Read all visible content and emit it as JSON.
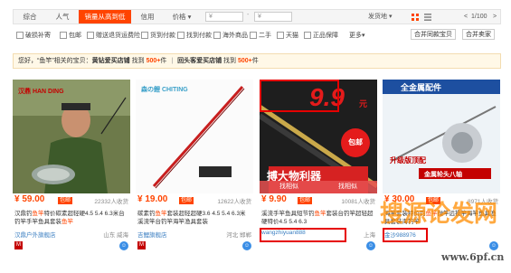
{
  "sortbar": {
    "tabs": [
      "综合",
      "人气",
      "销量从高到低",
      "信用",
      "价格"
    ],
    "price_from_placeholder": "¥",
    "price_dash": "-",
    "price_to_placeholder": "¥",
    "ship_from": "发货地",
    "page_indicator": "1/100",
    "prev": "<",
    "next": ">"
  },
  "filters": {
    "checkboxes": [
      "破损补寄",
      "包邮",
      "赠送退货运费险",
      "货到付款",
      "找到付款",
      "海外商品",
      "二手",
      "天猫",
      "正品保障"
    ],
    "more": "更多",
    "btn_merge_purchase": "合并同款宝贝",
    "btn_merge_seller": "合并卖家"
  },
  "notice": {
    "prefix": "您好，“鱼竿”相关的宝贝：",
    "gold": "黄钻爱买店铺",
    "found1": "找到",
    "count1": "500+",
    "unit1": "件",
    "sep": "|",
    "return": "回头客爱买店铺",
    "found2": "找到",
    "count2": "500+",
    "unit2": "件"
  },
  "products": [
    {
      "price": "¥ 59.00",
      "badge": "包邮",
      "sales": "22332人收货",
      "title_pre": "汉鼎钓",
      "title_kw": "鱼竿",
      "title_post": "特价碳素超轻硬4.5 5.4 6.3米台钓竿手竿鱼具套装",
      "title_kw2": "鱼竿",
      "shop": "汉鼎户外旗舰店",
      "location": "山东 威海",
      "img_brand": "汉鼎 HAN DING"
    },
    {
      "price": "¥ 19.00",
      "badge": "包邮",
      "sales": "12622人收货",
      "title_pre": "碳素钓",
      "title_kw": "鱼竿",
      "title_post": "套装超轻超硬3.6 4.5 5.4 6.3米溪流竿台钓竿海竿渔具套装",
      "title_kw2": "",
      "shop": "吉鲤旗舰店",
      "location": "河北 邯郸",
      "img_brand": "森の鲤 CHITING"
    },
    {
      "price": "¥ 9.90",
      "badge": "包邮",
      "sales": "10081人收货",
      "title_pre": "溪流手竿鱼具短节钓",
      "title_kw": "鱼竿",
      "title_post": "套装台钓竿超轻超硬特价4.5 5.4 6.3",
      "title_kw2": "",
      "shop": "wangzhiyuan888",
      "location": "上海",
      "img_price": "9.9",
      "img_yuan": "元",
      "img_mail": "包邮",
      "img_slogan": "搏大物利器",
      "tab_left": "找相似",
      "tab_right": "找相似"
    },
    {
      "price": "¥ 30.00",
      "badge": "包邮",
      "sales": "8971人收货",
      "title_pre": "海竿套装特价钓",
      "title_kw": "鱼竿",
      "title_post": "抛竿远投竿海竿鱼具渔具套装海钓竿",
      "title_kw2": "",
      "shop": "金沙988976",
      "location": "",
      "img_banner": "全金属配件",
      "img_tag1": "升级版顶配",
      "img_tag2": "金属轮头八轴"
    }
  ],
  "watermark": {
    "cn": "搜源论发网",
    "url": "www.6pf.cn"
  },
  "icons": {
    "tmall": "tmall-icon",
    "wangwang": "wangwang-icon"
  }
}
